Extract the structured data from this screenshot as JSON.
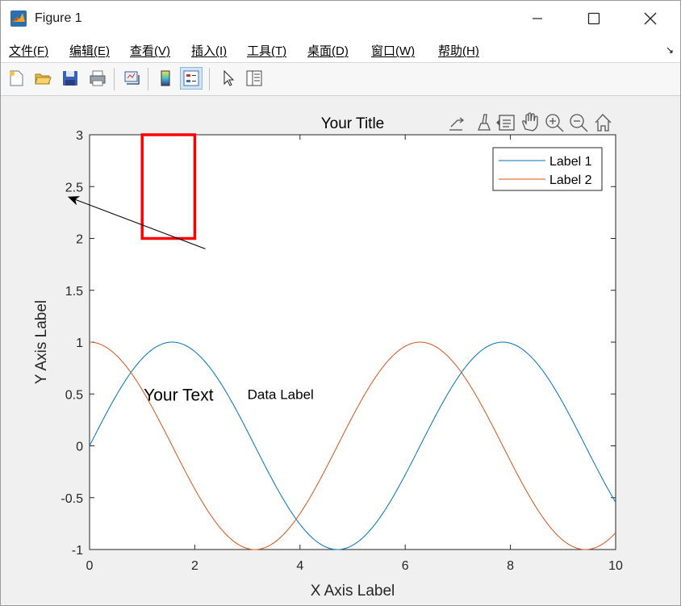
{
  "window": {
    "title": "Figure 1"
  },
  "menu": {
    "items": [
      "文件(F)",
      "编辑(E)",
      "查看(V)",
      "插入(I)",
      "工具(T)",
      "桌面(D)",
      "窗口(W)",
      "帮助(H)"
    ]
  },
  "toolbar": {
    "buttons": [
      "new-figure-icon",
      "open-file-icon",
      "save-icon",
      "print-icon",
      "link-plot-icon",
      "colorbar-icon",
      "legend-icon",
      "pointer-icon",
      "property-inspector-icon"
    ]
  },
  "axes_toolbar": [
    "export-icon",
    "brush-icon",
    "data-tips-icon",
    "pan-icon",
    "zoom-in-icon",
    "zoom-out-icon",
    "home-icon"
  ],
  "chart_data": {
    "type": "line",
    "title": "Your Title",
    "xlabel": "X Axis Label",
    "ylabel": "Y Axis Label",
    "xlim": [
      0,
      10
    ],
    "ylim": [
      -1,
      3
    ],
    "xticks": [
      "0",
      "2",
      "4",
      "6",
      "8",
      "10"
    ],
    "yticks": [
      "-1",
      "-0.5",
      "0",
      "0.5",
      "1",
      "1.5",
      "2",
      "2.5",
      "3"
    ],
    "series": [
      {
        "name": "Label 1",
        "function": "sin(x)",
        "color": "#0072BD"
      },
      {
        "name": "Label 2",
        "function": "cos(x)",
        "color": "#D95319"
      }
    ],
    "legend": "top-right",
    "annotations": {
      "text_1": "Your Text",
      "text_2": "Data Label",
      "rectangle": {
        "x": [
          1,
          2
        ],
        "y": [
          2,
          3
        ],
        "color": "#ff0000"
      },
      "arrow": {
        "from": [
          2.2,
          1.9
        ],
        "to": [
          -0.4,
          2.4
        ]
      }
    }
  }
}
